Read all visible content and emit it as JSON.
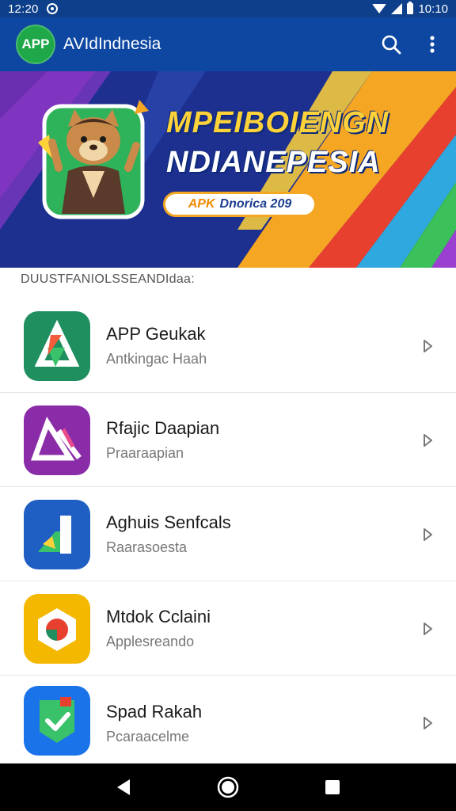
{
  "status_bar": {
    "time": "12:20",
    "clock": "10:10"
  },
  "app_bar": {
    "logo_text": "APP",
    "title": "AVIdIndnesia",
    "search_icon": "search-icon",
    "more_icon": "more-vert-icon"
  },
  "banner": {
    "title_line_1": "MPEIBOIENGN",
    "title_line_2": "NDIANEPESIA",
    "pill_part_1": "APK",
    "pill_part_2": "Dnorica 209",
    "mascot_icon": "mascot-illustration"
  },
  "section": {
    "label": "DUUSTFANIOLSSEANDIdaa:"
  },
  "apps": [
    {
      "title": "APP Geukak",
      "subtitle": "Antkingac Haah",
      "icon": "app-geukak-icon",
      "accent": "#1f8f5f"
    },
    {
      "title": "Rfajic Daapian",
      "subtitle": "Praaraapian",
      "icon": "rfajic-daapian-icon",
      "accent": "#8a2ca8"
    },
    {
      "title": "Aghuis Senfcals",
      "subtitle": "Raarasoesta",
      "icon": "aghuis-senfcals-icon",
      "accent": "#1f5fc4"
    },
    {
      "title": "Mtdok Cclaini",
      "subtitle": "Applesreando",
      "icon": "mtdok-cclaini-icon",
      "accent": "#f5b800"
    },
    {
      "title": "Spad Rakah",
      "subtitle": "Pcaraacelme",
      "icon": "spad-rakah-icon",
      "accent": "#1a73e8"
    }
  ],
  "nav": {
    "back_icon": "back-icon",
    "home_icon": "home-icon",
    "recents_icon": "recents-icon"
  },
  "colors": {
    "app_bar": "#0d47a1",
    "banner_bg": "#1d2f8f",
    "accent_yellow": "#ffd23a"
  }
}
